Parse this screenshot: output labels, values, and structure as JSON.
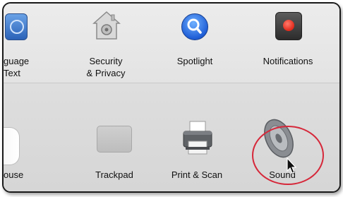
{
  "panes_row1": [
    {
      "label": "guage\nText",
      "icon": "language-text-icon"
    },
    {
      "label": "Security\n& Privacy",
      "icon": "security-house-icon"
    },
    {
      "label": "Spotlight",
      "icon": "spotlight-search-icon"
    },
    {
      "label": "Notifications",
      "icon": "notifications-icon"
    }
  ],
  "panes_row2": [
    {
      "label": "ouse",
      "icon": "mouse-icon"
    },
    {
      "label": "Trackpad",
      "icon": "trackpad-icon"
    },
    {
      "label": "Print & Scan",
      "icon": "printer-icon"
    },
    {
      "label": "Sound",
      "icon": "speaker-icon"
    }
  ],
  "colors": {
    "highlight": "#d6283a",
    "spotlight_blue": "#1f5ed6",
    "notification_red": "#e0281a"
  }
}
